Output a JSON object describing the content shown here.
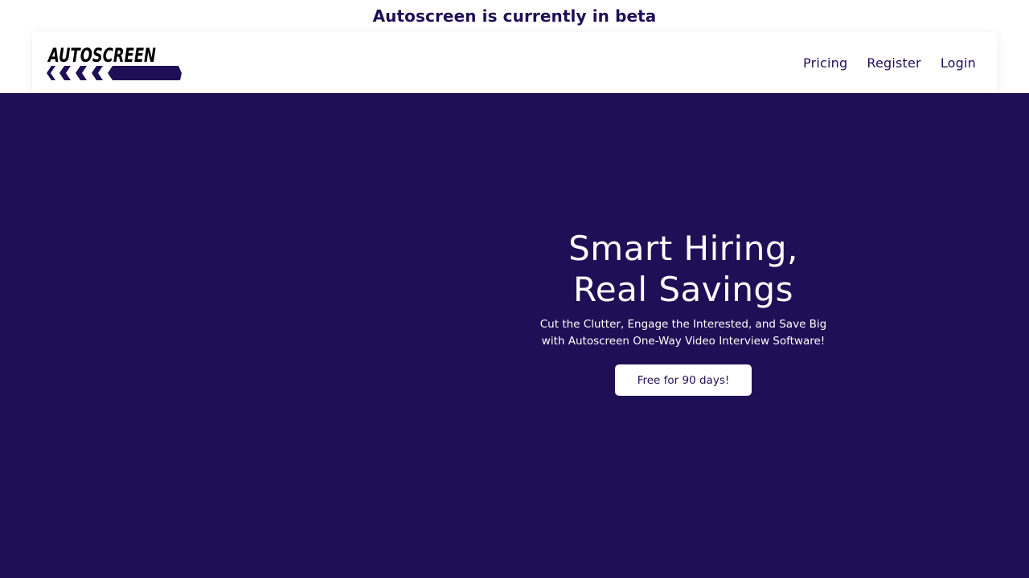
{
  "banner": {
    "text": "Autoscreen is currently in beta"
  },
  "header": {
    "logo_text": "AUTOSCREEN",
    "nav": [
      {
        "label": "Pricing"
      },
      {
        "label": "Register"
      },
      {
        "label": "Login"
      }
    ]
  },
  "hero": {
    "title_line1": "Smart Hiring,",
    "title_line2": "Real Savings",
    "subtitle_line1": "Cut the Clutter, Engage the Interested, and Save Big",
    "subtitle_line2": "with Autoscreen One-Way Video Interview Software!",
    "cta_label": "Free for 90 days!"
  },
  "colors": {
    "brand": "#1f0f56",
    "background": "#ffffff",
    "text_on_brand": "#ffffff"
  }
}
